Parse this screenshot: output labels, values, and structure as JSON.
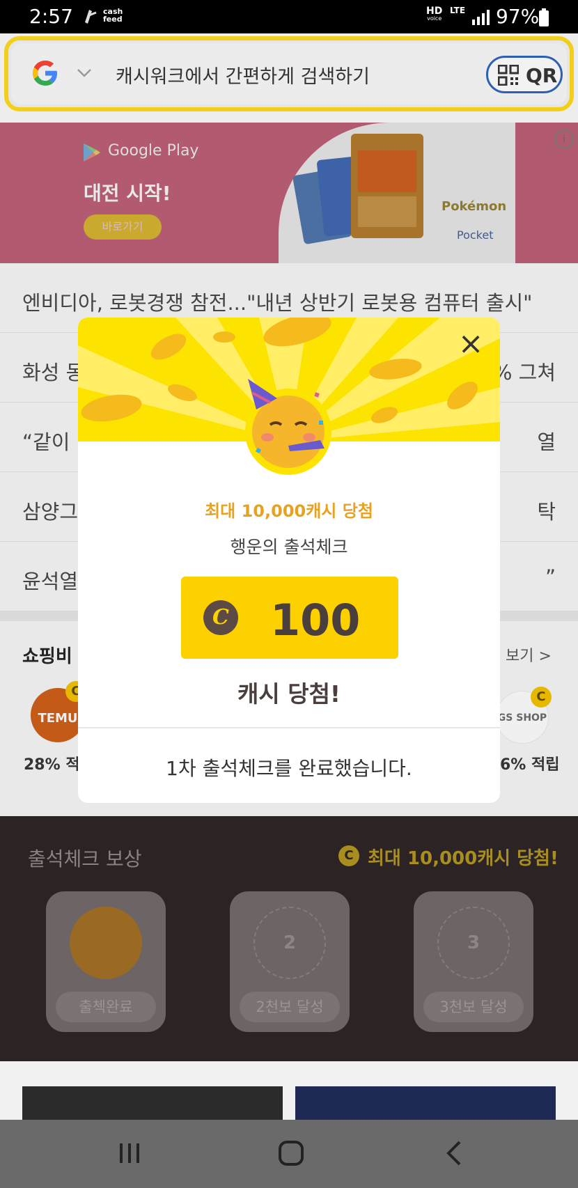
{
  "status_bar": {
    "time": "2:57",
    "notif_text": "cash feed",
    "hd": "HD",
    "hd_sub": "voice",
    "lte": "LTE",
    "battery": "97%"
  },
  "search": {
    "placeholder": "캐시워크에서 간편하게 검색하기",
    "qr_label": "QR"
  },
  "banner": {
    "store": "Google Play",
    "headline": "대전 시작!",
    "cta": "바로가기",
    "brand": "Pokémon",
    "brand_sub": "Pocket",
    "info": "i"
  },
  "news": [
    {
      "text": "엔비디아, 로봇경쟁 참전...\"내년 상반기 로봇용 컴퓨터 출시\"",
      "tail": ""
    },
    {
      "text": "화성 동",
      "tail": "% 그쳐"
    },
    {
      "text": "“같이 ",
      "tail": "열"
    },
    {
      "text": "삼양그",
      "tail": "탁"
    },
    {
      "text": "윤석열",
      "tail": "”"
    }
  ],
  "shopping": {
    "title": "쇼핑비",
    "more": "보기 >",
    "left_store": "TEMU",
    "left_rate": "28% 적",
    "right_store": "GS SHOP",
    "right_rate": "6% 적립",
    "badge": "C"
  },
  "attendance": {
    "title": "출석체크 보상",
    "reward": "최대 10,000캐시 당첨!",
    "coin": "C",
    "days": [
      {
        "num": "",
        "label": "출첵완료"
      },
      {
        "num": "2",
        "label": "2천보 달성"
      },
      {
        "num": "3",
        "label": "3천보 달성"
      }
    ]
  },
  "modal": {
    "close": "×",
    "headline": "최대 10,000캐시 당첨",
    "subhead": "행운의 출석체크",
    "coin": "C",
    "amount": "100",
    "won": "캐시 당첨!",
    "message": "1차 출석체크를 완료했습니다."
  },
  "colors": {
    "accent_yellow": "#fdd000",
    "reward_orange": "#e8a221",
    "search_border": "#f2cf1b",
    "qr_blue": "#2f5fb3"
  },
  "icons": [
    "cashfeed-icon",
    "signal-icon",
    "battery-icon",
    "google-icon",
    "chevron-down-icon",
    "qr-icon",
    "google-play-icon",
    "info-icon",
    "coin-icon",
    "close-icon",
    "party-emoji-icon",
    "recent-apps-icon",
    "home-icon",
    "back-icon"
  ]
}
